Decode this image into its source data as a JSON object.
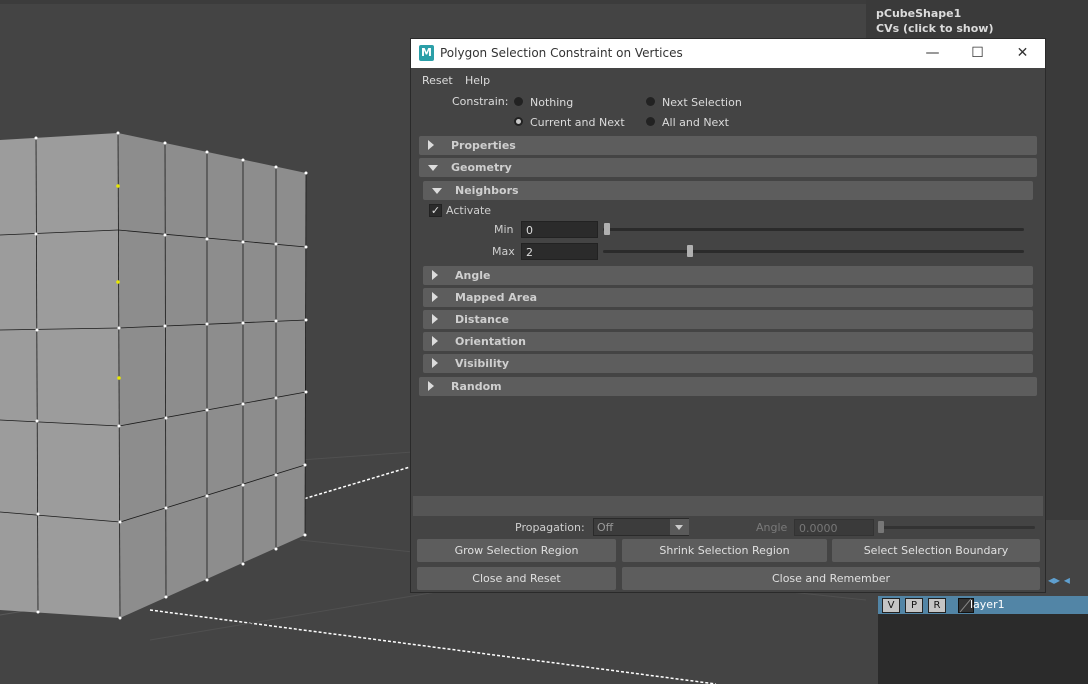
{
  "dialog": {
    "title": "Polygon Selection Constraint on Vertices",
    "icon_letter": "M",
    "window_buttons": {
      "minimize": "—",
      "maximize": "☐",
      "close": "✕"
    },
    "menu": [
      "Reset",
      "Help"
    ],
    "constrain": {
      "label": "Constrain:",
      "options": [
        "Nothing",
        "Next Selection",
        "Current and Next",
        "All and Next"
      ],
      "selected": "Current and Next"
    },
    "frames": {
      "properties": "Properties",
      "geometry": "Geometry",
      "neighbors": "Neighbors",
      "angle": "Angle",
      "mapped_area": "Mapped Area",
      "distance": "Distance",
      "orientation": "Orientation",
      "visibility": "Visibility",
      "random": "Random"
    },
    "neighbors": {
      "activate_label": "Activate",
      "activate_checked": true,
      "check_glyph": "✓",
      "min_label": "Min",
      "min_value": "0",
      "max_label": "Max",
      "max_value": "2"
    },
    "propagation": {
      "label": "Propagation:",
      "value": "Off",
      "angle_label": "Angle",
      "angle_value": "0.0000"
    },
    "buttons": {
      "grow": "Grow Selection Region",
      "shrink": "Shrink Selection Region",
      "boundary": "Select Selection Boundary",
      "close_reset": "Close and Reset",
      "close_remember": "Close and Remember"
    }
  },
  "right_panel": {
    "shape_name": "pCubeShape1",
    "cvs_hint": "CVs (click to show)"
  },
  "layers": {
    "visible_btn": "V",
    "playback_btn": "P",
    "reference_btn": "R",
    "layer_name": "layer1",
    "nav_arrows": "◂▸ ◂"
  },
  "colors": {
    "viewport_bg": "#444444",
    "cube_face": "#9a9a9a",
    "dialog_bg": "#444444",
    "frame_bg": "#5d5d5d",
    "layer_highlight": "#5285a6",
    "selected_vertex": "#e8e800"
  }
}
